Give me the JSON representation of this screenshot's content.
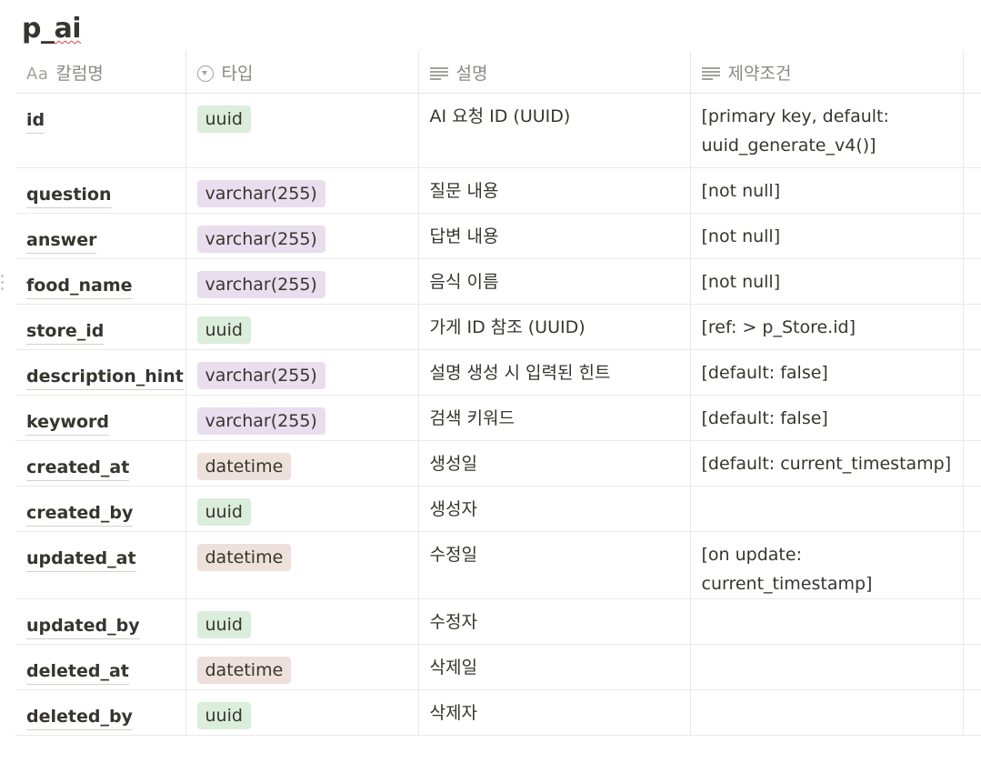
{
  "page": {
    "title_prefix": "p_",
    "title_marked": "ai"
  },
  "table": {
    "columns": [
      {
        "label": "칼럼명",
        "icon": "text-title-icon",
        "icon_text": "Aa"
      },
      {
        "label": "타입",
        "icon": "select-property-icon"
      },
      {
        "label": "설명",
        "icon": "text-property-icon"
      },
      {
        "label": "제약조건",
        "icon": "text-property-icon"
      }
    ],
    "rows": [
      {
        "name": "id",
        "type": "uuid",
        "type_color": "green",
        "description": "AI 요청 ID (UUID)",
        "constraint": "[primary key, default: uuid_generate_v4()]"
      },
      {
        "name": "question",
        "type": "varchar(255)",
        "type_color": "purple",
        "description": "질문 내용",
        "constraint": "[not null]"
      },
      {
        "name": "answer",
        "type": "varchar(255)",
        "type_color": "purple",
        "description": "답변 내용",
        "constraint": "[not null]"
      },
      {
        "name": "food_name",
        "type": "varchar(255)",
        "type_color": "purple",
        "description": "음식 이름",
        "constraint": "[not null]"
      },
      {
        "name": "store_id",
        "type": "uuid",
        "type_color": "green",
        "description": "가게 ID 참조 (UUID)",
        "constraint": "[ref: > p_Store.id]"
      },
      {
        "name": "description_hint",
        "type": "varchar(255)",
        "type_color": "purple",
        "description": "설명 생성 시 입력된 힌트",
        "constraint": "[default: false]"
      },
      {
        "name": "keyword",
        "type": "varchar(255)",
        "type_color": "purple",
        "description": "검색 키워드",
        "constraint": "[default: false]"
      },
      {
        "name": "created_at",
        "type": "datetime",
        "type_color": "brown",
        "description": "생성일",
        "constraint": "[default: current_timestamp]"
      },
      {
        "name": "created_by",
        "type": "uuid",
        "type_color": "green",
        "description": "생성자",
        "constraint": ""
      },
      {
        "name": "updated_at",
        "type": "datetime",
        "type_color": "brown",
        "description": "수정일",
        "constraint": "[on update: current_timestamp]"
      },
      {
        "name": "updated_by",
        "type": "uuid",
        "type_color": "green",
        "description": "수정자",
        "constraint": ""
      },
      {
        "name": "deleted_at",
        "type": "datetime",
        "type_color": "brown",
        "description": "삭제일",
        "constraint": ""
      },
      {
        "name": "deleted_by",
        "type": "uuid",
        "type_color": "green",
        "description": "삭제자",
        "constraint": ""
      }
    ]
  },
  "colors": {
    "tag_green": "#dbeddb",
    "tag_purple": "#e8deee",
    "tag_brown": "#eee0da",
    "text": "#37352f",
    "header_text": "#8a8985"
  }
}
